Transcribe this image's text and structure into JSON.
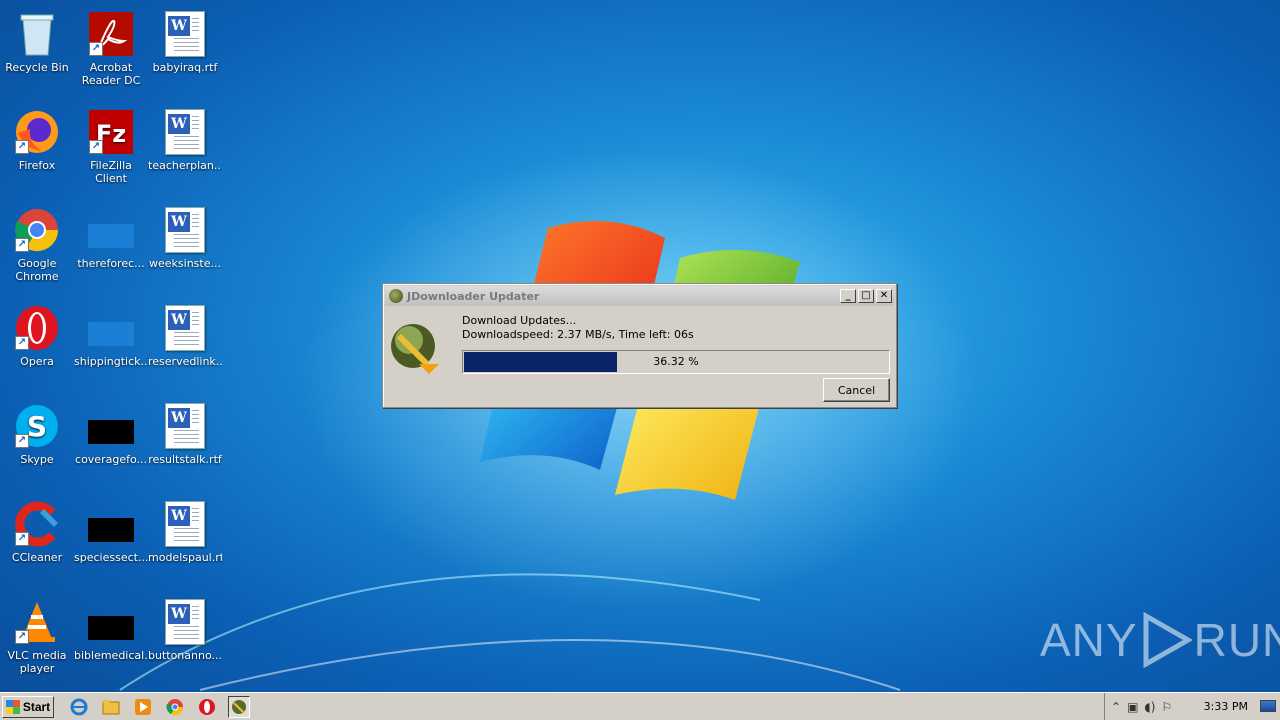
{
  "desktop": {
    "icons": [
      {
        "label": "Recycle Bin"
      },
      {
        "label": "Acrobat Reader DC"
      },
      {
        "label": "babyiraq.rtf"
      },
      {
        "label": "Firefox"
      },
      {
        "label": "FileZilla Client"
      },
      {
        "label": "teacherplan..."
      },
      {
        "label": "Google Chrome"
      },
      {
        "label": "thereforec..."
      },
      {
        "label": "weeksinste..."
      },
      {
        "label": "Opera"
      },
      {
        "label": "shippingtick..."
      },
      {
        "label": "reservedlink..."
      },
      {
        "label": "Skype"
      },
      {
        "label": "coveragefo..."
      },
      {
        "label": "resultstalk.rtf"
      },
      {
        "label": "CCleaner"
      },
      {
        "label": "speciessect..."
      },
      {
        "label": "modelspaul.rtf"
      },
      {
        "label": "VLC media player"
      },
      {
        "label": "biblemedical..."
      },
      {
        "label": "buttonanno..."
      }
    ]
  },
  "dialog": {
    "title": "JDownloader Updater",
    "status_line": "Download Updates...",
    "speed_line": "Downloadspeed: 2.37 MB/s, Time left: 06s",
    "progress_percent": 36.32,
    "progress_text": "36.32 %",
    "cancel_label": "Cancel",
    "minimize_glyph": "_",
    "maximize_glyph": "□",
    "close_glyph": "✕"
  },
  "watermark": {
    "left": "ANY",
    "right": "RUN"
  },
  "taskbar": {
    "start_label": "Start",
    "clock": "3:33 PM"
  }
}
